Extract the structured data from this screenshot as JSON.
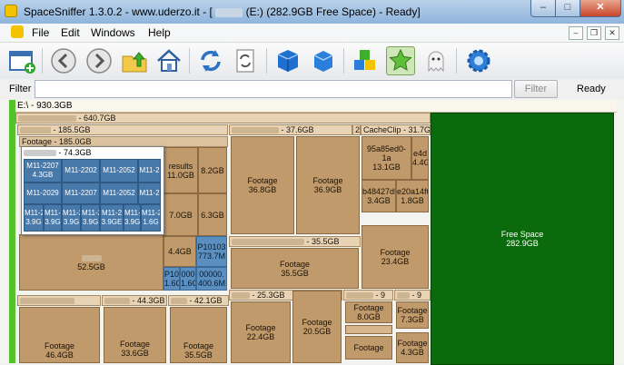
{
  "window": {
    "title": "SpaceSniffer 1.3.0.2 - www.uderzo.it - [",
    "title_tail": "(E:) (282.9GB Free Space) - Ready]",
    "min_label": "–",
    "max_label": "□",
    "close_label": "✕"
  },
  "menu": {
    "file": "File",
    "edit": "Edit",
    "windows": "Windows",
    "help": "Help",
    "mdi_min": "–",
    "mdi_restore": "❐",
    "mdi_close": "✕"
  },
  "toolbar": {
    "icons": [
      "new-view-icon",
      "back-icon",
      "forward-icon",
      "up-folder-icon",
      "home-icon",
      "refresh-icon",
      "rescan-icon",
      "blue-cube-icon",
      "blue-cube-icon",
      "multi-cube-icon",
      "star-icon",
      "ghost-icon",
      "settings-gear-icon"
    ]
  },
  "filter": {
    "label": "Filter",
    "value": "",
    "button": "Filter",
    "status": "Ready"
  },
  "treemap": {
    "root": "E:\\ - 930.3GB",
    "big_header": "- 640.7GB",
    "sub_header": "- 185.5GB",
    "footage_185": "Footage - 185.0GB",
    "popup_header": "- 74.3GB",
    "popup_cells": [
      "M11-2207\n4.3GB",
      "M11-2202",
      "M11-2052",
      "M11-2",
      "M11-2029",
      "M11-2207",
      "M11-2052",
      "M11-2",
      "M11-2\n3.9G",
      "M11-2\n3.9G",
      "M11-2\n3.9G",
      "M11-2\n3.9G",
      "M11-2\n3.9GE",
      "M11-2\n3.9G",
      "M11-2\n1.6G"
    ],
    "results": "results\n11.0GB",
    "c82": "8.2GB",
    "c70": "7.0GB",
    "c63": "6.3GB",
    "c44": "4.4GB",
    "p10103": "P10103\n773.7M",
    "p10": "P10\n1.6G",
    "c000": "000\n1.6G",
    "c00000": "00000.\n400.6M",
    "c525": "52.5GB",
    "h376": "- 37.6GB",
    "h2": "2",
    "cacheclip": "CacheClip - 31.7GB",
    "f368": "Footage\n36.8GB",
    "f369": "Footage\n36.9GB",
    "c95": "95a85ed0-1a\n13.1GB",
    "e4d": "e4d\n4.4G",
    "b48": "b48427d5\n3.4GB",
    "e20": "e20a14f6\n1.8GB",
    "h355": "- 35.5GB",
    "f355": "Footage\n35.5GB",
    "f234": "Footage\n23.4GB",
    "h443": "- 44.3GB",
    "h421": "- 42.1GB",
    "h253": "- 25.3GB",
    "h9a": "- 9",
    "h9b": "- 9",
    "f464": "Footage\n46.4GB",
    "f336": "Footage\n33.6GB",
    "f355b": "Footage\n35.5GB",
    "f224": "Footage\n22.4GB",
    "f205": "Footage\n20.5GB",
    "f80": "Footage\n8.0GB",
    "f73": "Footage\n7.3GB",
    "f_small": "Footage",
    "f43": "Footage\n4.3GB",
    "free": "Free Space\n282.9GB"
  }
}
